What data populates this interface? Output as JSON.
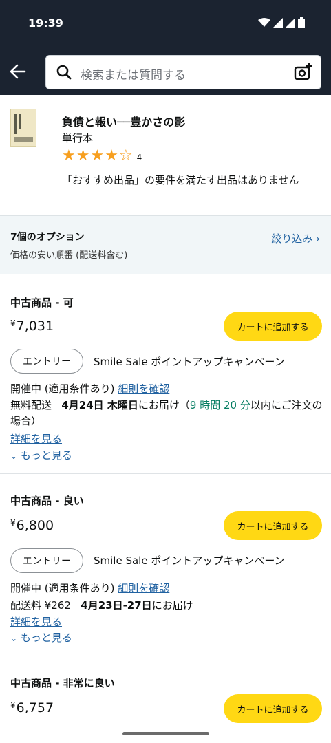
{
  "status": {
    "time": "19:39"
  },
  "search": {
    "placeholder": "検索または質問する"
  },
  "product": {
    "title": "負債と報い──豊かさの影",
    "format": "単行本",
    "rating_stars": 4,
    "rating_count": "4",
    "notice": "「おすすめ出品」の要件を満たす出品はありません"
  },
  "options": {
    "count": "7個のオプション",
    "sort": "価格の安い順番 (配送料含む)",
    "filter": "絞り込み ›"
  },
  "offers": [
    {
      "condition": "中古商品 - 可",
      "currency": "¥",
      "price": "7,031",
      "cart": "カートに追加する",
      "entry": "エントリー",
      "campaign": "Smile Sale ポイントアップキャンペーン",
      "status_prefix": "開催中 (適用条件あり)",
      "rules_link": "細則を確認",
      "shipping": "無料配送",
      "delivery_date": "4月24日 木曜日",
      "delivery_suffix": "にお届け（",
      "order_time": "9 時間 20 分",
      "order_suffix": "以内にご注文の場合）",
      "details": "詳細を見る",
      "more": "もっと見る"
    },
    {
      "condition": "中古商品 - 良い",
      "currency": "¥",
      "price": "6,800",
      "cart": "カートに追加する",
      "entry": "エントリー",
      "campaign": "Smile Sale ポイントアップキャンペーン",
      "status_prefix": "開催中 (適用条件あり)",
      "rules_link": "細則を確認",
      "shipping": "配送料 ¥262",
      "delivery_date": "4月23日-27日",
      "delivery_suffix": "にお届け",
      "details": "詳細を見る",
      "more": "もっと見る"
    },
    {
      "condition": "中古商品 - 非常に良い",
      "currency": "¥",
      "price": "6,757",
      "cart": "カートに追加する"
    }
  ],
  "colors": {
    "header_bg": "#1b2330",
    "cart_button": "#ffd814",
    "link": "#2162a1",
    "star": "#f79f1f",
    "teal": "#067d62"
  }
}
